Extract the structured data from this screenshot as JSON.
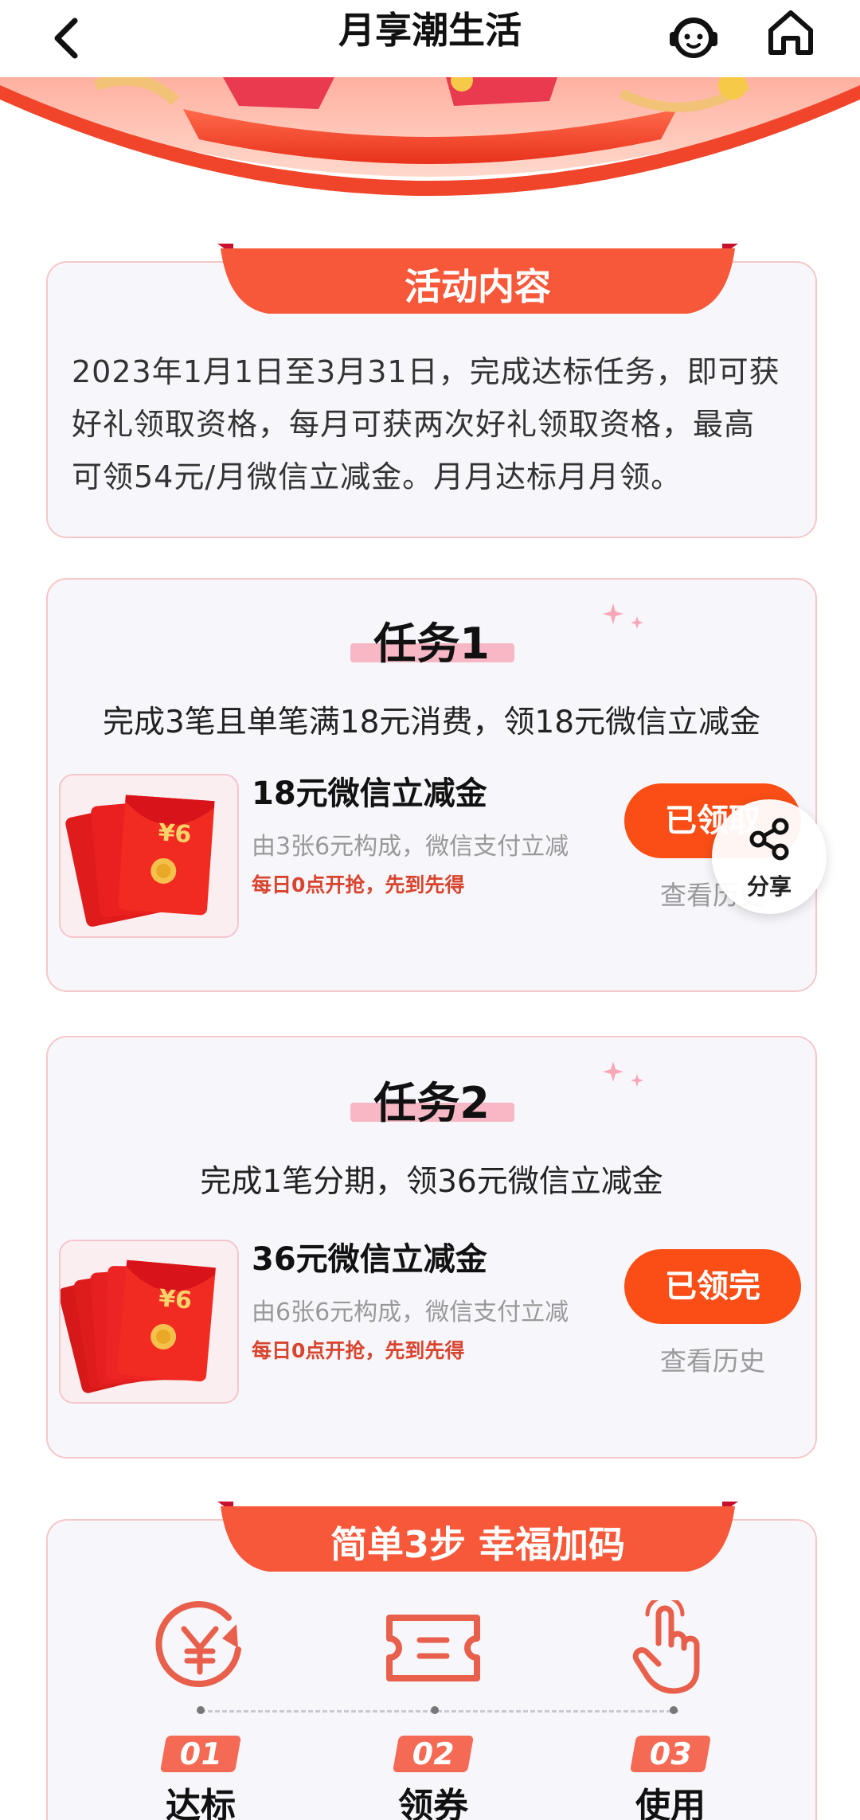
{
  "header": {
    "title": "月享潮生活",
    "back_icon": "chevron-left-icon",
    "service_icon": "customer-service-icon",
    "home_icon": "home-icon"
  },
  "colors": {
    "primary": "#fa4e16",
    "ribbon": "#f7583a",
    "card_border": "#f6c7c7",
    "card_bg": "#f7f7fb",
    "note_red": "#d9442f"
  },
  "activity": {
    "heading": "活动内容",
    "lines": [
      "2023年1月1日至3月31日，完成达标任务，即可获",
      "好礼领取资格，每月可获两次好礼领取资格，最高",
      "可领54元/月微信立减金。月月达标月月领。"
    ]
  },
  "tasks": [
    {
      "title": "任务1",
      "desc": "完成3笔且单笔满18元消费，领18元微信立减金",
      "prize_name": "18元微信立减金",
      "prize_sub": "由3张6元构成，微信支付立减",
      "prize_note": "每日0点开抢，先到先得",
      "envelope_value": "¥6",
      "button": "已领取",
      "history": "查看历史"
    },
    {
      "title": "任务2",
      "desc": "完成1笔分期，领36元微信立减金",
      "prize_name": "36元微信立减金",
      "prize_sub": "由6张6元构成，微信支付立减",
      "prize_note": "每日0点开抢，先到先得",
      "envelope_value": "¥6",
      "button": "已领完",
      "history": "查看历史"
    }
  ],
  "share": {
    "label": "分享",
    "icon": "share-icon"
  },
  "steps": {
    "heading": "简单3步 幸福加码",
    "items": [
      {
        "num": "01",
        "label": "达标",
        "icon": "yen-coin-icon"
      },
      {
        "num": "02",
        "label": "领券",
        "icon": "ticket-icon"
      },
      {
        "num": "03",
        "label": "使用",
        "icon": "tap-hand-icon"
      }
    ]
  }
}
